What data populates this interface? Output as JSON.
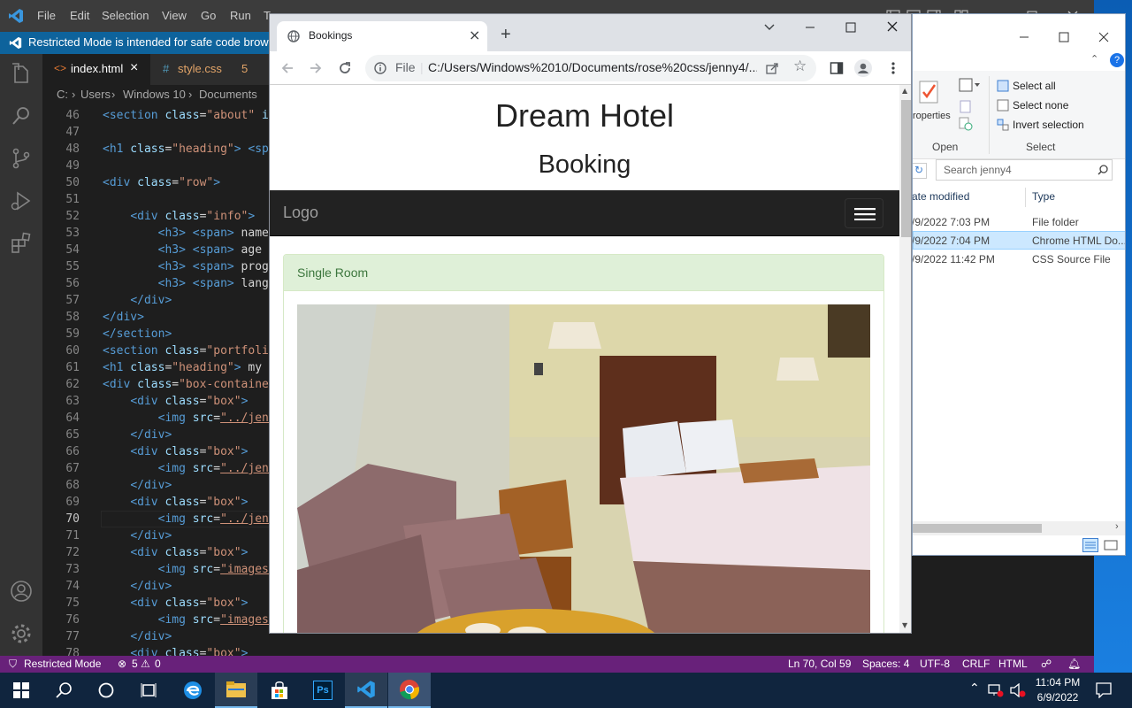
{
  "colors": {
    "vscode_status": "#68217a",
    "vscode_banner": "#0e639c",
    "hotel_navbar": "#222222",
    "panel_heading_bg": "#dff0d8",
    "panel_heading_text": "#3c763d"
  },
  "vscode": {
    "menu": [
      "File",
      "Edit",
      "Selection",
      "View",
      "Go",
      "Run",
      "Te"
    ],
    "banner": "Restricted Mode is intended for safe code browsing",
    "tabs": [
      {
        "label": "index.html",
        "icon": "html-icon",
        "close": "×"
      },
      {
        "label": "style.css",
        "icon": "css-icon",
        "problems": "5"
      }
    ],
    "breadcrumb": [
      "C:",
      "Users",
      "Windows 10",
      "Documents"
    ],
    "activity_icons": [
      "explorer-icon",
      "search-icon",
      "source-control-icon",
      "run-debug-icon",
      "extensions-icon",
      "account-icon",
      "settings-gear-icon"
    ],
    "lines": [
      {
        "n": "46",
        "tokens": [
          [
            "tg",
            "<section"
          ],
          [
            "at",
            " class"
          ],
          [
            "tx",
            "="
          ],
          [
            "st",
            "\"about\""
          ],
          [
            "at",
            " id"
          ]
        ]
      },
      {
        "n": "47",
        "tokens": []
      },
      {
        "n": "48",
        "tokens": [
          [
            "tg",
            "<h1"
          ],
          [
            "at",
            " class"
          ],
          [
            "tx",
            "="
          ],
          [
            "st",
            "\"heading\""
          ],
          [
            "tg",
            "> <spa"
          ]
        ]
      },
      {
        "n": "49",
        "tokens": []
      },
      {
        "n": "50",
        "tokens": [
          [
            "tg",
            "<div"
          ],
          [
            "at",
            " class"
          ],
          [
            "tx",
            "="
          ],
          [
            "st",
            "\"row\""
          ],
          [
            "tg",
            ">"
          ]
        ]
      },
      {
        "n": "51",
        "tokens": []
      },
      {
        "n": "52",
        "tokens": [
          [
            "tx",
            "    "
          ],
          [
            "tg",
            "<div"
          ],
          [
            "at",
            " class"
          ],
          [
            "tx",
            "="
          ],
          [
            "st",
            "\"info\""
          ],
          [
            "tg",
            ">"
          ]
        ]
      },
      {
        "n": "53",
        "tokens": [
          [
            "tx",
            "        "
          ],
          [
            "tg",
            "<h3>"
          ],
          [
            "tx",
            " "
          ],
          [
            "tg",
            "<span>"
          ],
          [
            "tx",
            " name"
          ]
        ]
      },
      {
        "n": "54",
        "tokens": [
          [
            "tx",
            "        "
          ],
          [
            "tg",
            "<h3>"
          ],
          [
            "tx",
            " "
          ],
          [
            "tg",
            "<span>"
          ],
          [
            "tx",
            " age "
          ]
        ]
      },
      {
        "n": "55",
        "tokens": [
          [
            "tx",
            "        "
          ],
          [
            "tg",
            "<h3>"
          ],
          [
            "tx",
            " "
          ],
          [
            "tg",
            "<span>"
          ],
          [
            "tx",
            " progr"
          ]
        ]
      },
      {
        "n": "56",
        "tokens": [
          [
            "tx",
            "        "
          ],
          [
            "tg",
            "<h3>"
          ],
          [
            "tx",
            " "
          ],
          [
            "tg",
            "<span>"
          ],
          [
            "tx",
            " langu"
          ]
        ]
      },
      {
        "n": "57",
        "tokens": [
          [
            "tx",
            "    "
          ],
          [
            "tg",
            "</div>"
          ]
        ]
      },
      {
        "n": "58",
        "tokens": [
          [
            "tg",
            "</div>"
          ]
        ]
      },
      {
        "n": "59",
        "tokens": [
          [
            "tg",
            "</section>"
          ]
        ]
      },
      {
        "n": "60",
        "tokens": [
          [
            "tg",
            "<section"
          ],
          [
            "at",
            " class"
          ],
          [
            "tx",
            "="
          ],
          [
            "st",
            "\"portfolio"
          ]
        ]
      },
      {
        "n": "61",
        "tokens": [
          [
            "tg",
            "<h1"
          ],
          [
            "at",
            " class"
          ],
          [
            "tx",
            "="
          ],
          [
            "st",
            "\"heading\""
          ],
          [
            "tg",
            ">"
          ],
          [
            "tx",
            " my "
          ]
        ]
      },
      {
        "n": "62",
        "tokens": [
          [
            "tg",
            "<div"
          ],
          [
            "at",
            " class"
          ],
          [
            "tx",
            "="
          ],
          [
            "st",
            "\"box-container"
          ]
        ]
      },
      {
        "n": "63",
        "tokens": [
          [
            "tx",
            "    "
          ],
          [
            "tg",
            "<div"
          ],
          [
            "at",
            " class"
          ],
          [
            "tx",
            "="
          ],
          [
            "st",
            "\"box\""
          ],
          [
            "tg",
            ">"
          ]
        ]
      },
      {
        "n": "64",
        "tokens": [
          [
            "tx",
            "        "
          ],
          [
            "tg",
            "<img"
          ],
          [
            "at",
            " src"
          ],
          [
            "tx",
            "="
          ],
          [
            "ul",
            "\"../jenn"
          ]
        ]
      },
      {
        "n": "65",
        "tokens": [
          [
            "tx",
            "    "
          ],
          [
            "tg",
            "</div>"
          ]
        ]
      },
      {
        "n": "66",
        "tokens": [
          [
            "tx",
            "    "
          ],
          [
            "tg",
            "<div"
          ],
          [
            "at",
            " class"
          ],
          [
            "tx",
            "="
          ],
          [
            "st",
            "\"box\""
          ],
          [
            "tg",
            ">"
          ]
        ]
      },
      {
        "n": "67",
        "tokens": [
          [
            "tx",
            "        "
          ],
          [
            "tg",
            "<img"
          ],
          [
            "at",
            " src"
          ],
          [
            "tx",
            "="
          ],
          [
            "ul",
            "\"../jenn"
          ]
        ]
      },
      {
        "n": "68",
        "tokens": [
          [
            "tx",
            "    "
          ],
          [
            "tg",
            "</div>"
          ]
        ]
      },
      {
        "n": "69",
        "tokens": [
          [
            "tx",
            "    "
          ],
          [
            "tg",
            "<div"
          ],
          [
            "at",
            " class"
          ],
          [
            "tx",
            "="
          ],
          [
            "st",
            "\"box\""
          ],
          [
            "tg",
            ">"
          ]
        ]
      },
      {
        "n": "70",
        "tokens": [
          [
            "tx",
            "        "
          ],
          [
            "tg",
            "<img"
          ],
          [
            "at",
            " src"
          ],
          [
            "tx",
            "="
          ],
          [
            "ul",
            "\"../jenn"
          ]
        ]
      },
      {
        "n": "71",
        "tokens": [
          [
            "tx",
            "    "
          ],
          [
            "tg",
            "</div>"
          ]
        ]
      },
      {
        "n": "72",
        "tokens": [
          [
            "tx",
            "    "
          ],
          [
            "tg",
            "<div"
          ],
          [
            "at",
            " class"
          ],
          [
            "tx",
            "="
          ],
          [
            "st",
            "\"box\""
          ],
          [
            "tg",
            ">"
          ]
        ]
      },
      {
        "n": "73",
        "tokens": [
          [
            "tx",
            "        "
          ],
          [
            "tg",
            "<img"
          ],
          [
            "at",
            " src"
          ],
          [
            "tx",
            "="
          ],
          [
            "ul",
            "\"images/"
          ]
        ]
      },
      {
        "n": "74",
        "tokens": [
          [
            "tx",
            "    "
          ],
          [
            "tg",
            "</div>"
          ]
        ]
      },
      {
        "n": "75",
        "tokens": [
          [
            "tx",
            "    "
          ],
          [
            "tg",
            "<div"
          ],
          [
            "at",
            " class"
          ],
          [
            "tx",
            "="
          ],
          [
            "st",
            "\"box\""
          ],
          [
            "tg",
            ">"
          ]
        ]
      },
      {
        "n": "76",
        "tokens": [
          [
            "tx",
            "        "
          ],
          [
            "tg",
            "<img"
          ],
          [
            "at",
            " src"
          ],
          [
            "tx",
            "="
          ],
          [
            "ul",
            "\"images/"
          ]
        ]
      },
      {
        "n": "77",
        "tokens": [
          [
            "tx",
            "    "
          ],
          [
            "tg",
            "</div>"
          ]
        ]
      },
      {
        "n": "78",
        "tokens": [
          [
            "tx",
            "    "
          ],
          [
            "tg",
            "<div"
          ],
          [
            "at",
            " class"
          ],
          [
            "tx",
            "="
          ],
          [
            "st",
            "\"box\""
          ],
          [
            "tg",
            ">"
          ]
        ]
      }
    ],
    "current_line": "70",
    "status": {
      "restricted": "Restricted Mode",
      "errors": "5",
      "warnings": "0",
      "position": "Ln 70, Col 59",
      "spaces": "Spaces: 4",
      "encoding": "UTF-8",
      "eol": "CRLF",
      "language": "HTML"
    }
  },
  "explorer": {
    "ribbon": {
      "properties": "roperties",
      "open": "Open",
      "select_all": "Select all",
      "select_none": "Select none",
      "invert": "Invert selection",
      "select": "Select"
    },
    "search_placeholder": "Search jenny4",
    "columns": [
      "ate modified",
      "Type"
    ],
    "rows": [
      {
        "date": "/9/2022 7:03 PM",
        "type": "File folder"
      },
      {
        "date": "/9/2022 7:04 PM",
        "type": "Chrome HTML Do..."
      },
      {
        "date": "/9/2022 11:42 PM",
        "type": "CSS Source File"
      }
    ]
  },
  "chrome": {
    "tab_title": "Bookings",
    "tab_close": "×",
    "new_tab": "+",
    "url_scheme": "File",
    "url": "C:/Users/Windows%2010/Documents/rose%20css/jenny4/...",
    "page": {
      "title": "Dream Hotel",
      "subtitle": "Booking",
      "brand": "Logo",
      "panel_heading": "Single Room",
      "room_image": "hotel-room-photo"
    }
  },
  "taskbar": {
    "apps": [
      "start-icon",
      "search-icon",
      "cortana-icon",
      "task-view-icon",
      "edge-icon",
      "file-explorer-icon",
      "store-icon",
      "photoshop-icon",
      "vscode-icon",
      "chrome-icon"
    ],
    "ps_label": "Ps",
    "time": "11:04 PM",
    "date": "6/9/2022"
  }
}
